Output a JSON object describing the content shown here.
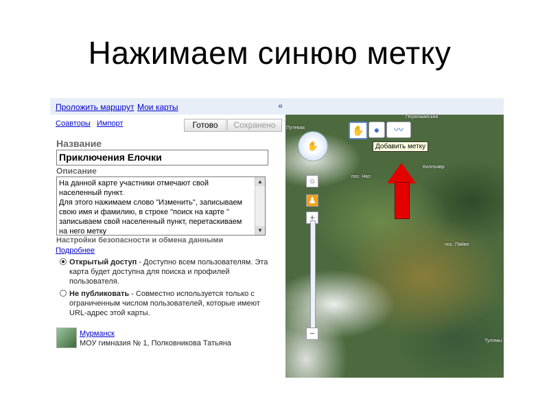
{
  "slide": {
    "title": "Нажимаем синюю метку"
  },
  "panel": {
    "links": {
      "route": "Проложить маршрут",
      "my_maps": "Мои карты"
    },
    "collapse": "«",
    "actions": {
      "coauthors": "Соавторы",
      "import": "Импорт",
      "done": "Готово",
      "saved": "Сохранено"
    },
    "name_label": "Название",
    "name_value": "Приключения Елочки",
    "desc_label": "Описание",
    "desc_value": "На данной карте участники отмечают свой населенный пункт.\nДля этого нажимаем слово \"Изменить\", записываем свою имя и фамилию, в строке \"поиск на карте \" записываем свой населенный пункт, перетаскиваем на него метку",
    "security_heading": "Настройки безопасности и обмена данными",
    "more_link": "Подробнее",
    "option_public_title": "Открытый доступ",
    "option_public_text": " - Доступно всем пользователям. Эта карта будет доступна для поиска и профилей пользователя.",
    "option_private_title": "Не публиковать",
    "option_private_text": " - Совместно используется только с ограниченным числом пользователей, которые имеют URL-адрес этой карты.",
    "selected_option": "public",
    "author_link": "Мурманск",
    "author_info": "МОУ гимназия № 1, Полковникова Татьяна"
  },
  "map": {
    "tooltip": "Добавить метку",
    "labels": {
      "pervomaisky": "Первомайский",
      "putevaya": "Путевая",
      "nyal": "пос. Нял",
      "kilpyavr": "Килпъявр",
      "pyaive": "пос. Пяйве",
      "tulomy": "Туломы"
    },
    "tools": {
      "hand": "hand-icon",
      "marker": "marker-icon",
      "line": "line-icon"
    },
    "colors": {
      "arrow": "#e30000",
      "tooltip_bg": "#ffffe1",
      "link": "#0000cc"
    }
  }
}
